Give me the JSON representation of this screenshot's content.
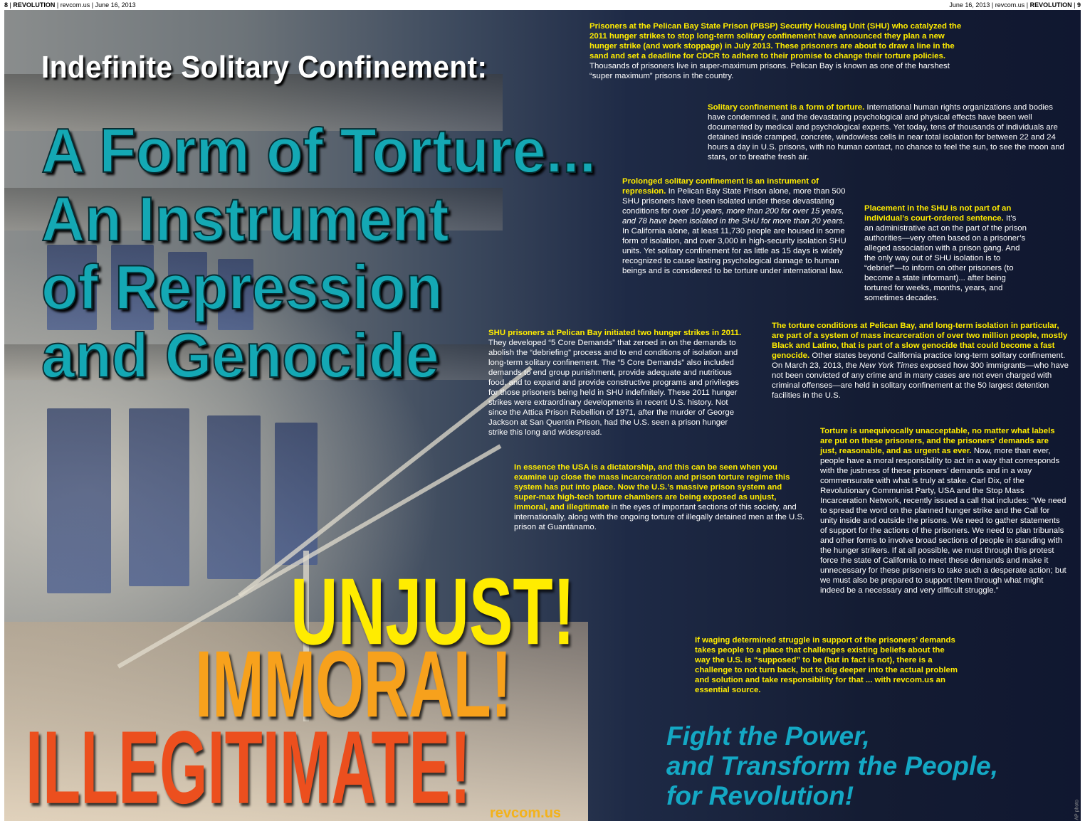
{
  "header": {
    "left_page": "8",
    "left_pub": "REVOLUTION",
    "left_site": "revcom.us",
    "left_date": "June 16, 2013",
    "right_date": "June 16, 2013",
    "right_site": "revcom.us",
    "right_pub": "REVOLUTION",
    "right_page": "9"
  },
  "kicker": "Indefinite Solitary Confinement:",
  "headline": [
    "A Form of Torture...",
    "An Instrument",
    "of Repression",
    "and Genocide"
  ],
  "big_words": [
    "UNJUST!",
    "IMMORAL!",
    "ILLEGITIMATE!"
  ],
  "slogan": [
    "Fight the Power,",
    "and Transform the People,",
    "for Revolution!"
  ],
  "site": "revcom.us",
  "photo_credit": "AP photo",
  "paragraphs": {
    "p1": {
      "lead": "Prisoners at the Pelican Bay State Prison (PBSP) Security Housing Unit (SHU) who catalyzed the 2011 hunger strikes to stop long-term solitary confinement have announced they plan a new hunger strike (and work stoppage) in July 2013. These prisoners are about to draw a line in the sand and set a deadline for CDCR to adhere to their promise to change their torture policies.",
      "body": " Thousands of prisoners live in super-maximum prisons. Pelican Bay is known as one of the harshest “super maximum” prisons in the country."
    },
    "p2": {
      "lead": "Solitary confinement is a form of torture.",
      "body": " International human rights organizations and bodies have condemned it, and the devastating psychological and physical effects have been well documented by medical and psychological experts. Yet today, tens of thousands of individuals are detained inside cramped, concrete, windowless cells in near total isolation for between 22 and 24 hours a day in U.S. prisons, with no human contact, no chance to feel the sun, to see the moon and stars, or to breathe fresh air."
    },
    "p3": {
      "lead": "Prolonged solitary confinement is an instrument of repression.",
      "body1": " In Pelican Bay State Prison alone, more than 500 SHU prisoners have been isolated under these devastating conditions for ",
      "italic": "over 10 years, more than 200 for over 15 years, and 78 have been isolated in the SHU for more than 20 years.",
      "body2": " In California alone, at least 11,730 people are housed in some form of isolation, and over 3,000 in high-security isolation SHU units. Yet solitary confinement for as little as 15 days is widely recognized to cause lasting psychological damage to human beings and is considered to be torture under international law."
    },
    "p4": {
      "lead": "Placement in the SHU is not part of an individual’s court-ordered sentence.",
      "body": " It’s an administrative act on the part of the prison authorities—very often based on a prisoner’s alleged association with a prison gang. And the only way out of SHU isolation is to “debrief”—to inform on other prisoners (to become a state informant)... after being tortured for weeks, months, years, and sometimes decades."
    },
    "p5": {
      "lead": "SHU prisoners at Pelican Bay initiated two hunger strikes in 2011.",
      "body": " They developed “5 Core Demands” that zeroed in on the demands to abolish the “debriefing” process and to end conditions of isolation and long-term solitary confinement. The “5 Core Demands” also included demands to end group punishment, provide adequate and nutritious food, and to expand and provide constructive programs and privileges for those prisoners being held in SHU indefinitely. These 2011 hunger strikes were extraordinary developments in recent U.S. history. Not since the Attica Prison Rebellion of 1971, after the murder of George Jackson at San Quentin Prison, had the U.S. seen a prison hunger strike this long and widespread."
    },
    "p6": {
      "lead": "The torture conditions at Pelican Bay, and long-term isolation in particular, are part of a system of mass incarceration of over two million people, mostly Black and Latino, that is part of a slow genocide that could become a fast genocide.",
      "body1": " Other states beyond California practice long-term solitary confinement. On March 23, 2013, the ",
      "italic": "New York Times",
      "body2": " exposed how 300 immigrants—who have not been convicted of any crime and in many cases are not even charged with criminal offenses—are held in solitary confinement at the 50 largest detention facilities in the U.S."
    },
    "p7": {
      "lead": "In essence the USA is a dictatorship, and this can be seen when you examine up close the mass incarceration and prison torture regime this system has put into place. Now the U.S.’s massive prison system and super-max high-tech torture chambers are being exposed as unjust, immoral, and illegitimate",
      "body": " in the eyes of important sections of this society, and internationally, along with the ongoing torture of illegally detained men at the U.S. prison at Guantánamo."
    },
    "p8": {
      "lead": "Torture is unequivocally unacceptable, no matter what labels are put on these prisoners, and the prisoners’ demands are just, reasonable, and as urgent as ever.",
      "body": " Now, more than ever, people have a moral responsibility to act in a way that corresponds with the justness of these prisoners’ demands and in a way commensurate with what is truly at stake. Carl Dix, of the Revolutionary Communist Party, USA and the Stop Mass Incarceration Network, recently issued a call that includes: “We need to spread the word on the planned hunger strike and the Call for unity inside and outside the prisons. We need to gather statements of support for the actions of the prisoners. We need to plan tribunals and other forms to involve broad sections of people in standing with the hunger strikers. If at all possible, we must through this protest force the state of California to meet these demands and make it unnecessary for these prisoners to take such a desperate action; but we must also be prepared to support them through what might indeed be a necessary and very difficult struggle.”"
    },
    "p9": {
      "lead": "If waging determined struggle in support of the prisoners’ demands takes people to a place that challenges existing beliefs about the way the U.S. is “supposed” to be (but in fact is not), there is a challenge to not turn back, but to dig deeper into the actual problem and solution and take responsibility for that ... with revcom.us an essential source.",
      "body": ""
    }
  }
}
